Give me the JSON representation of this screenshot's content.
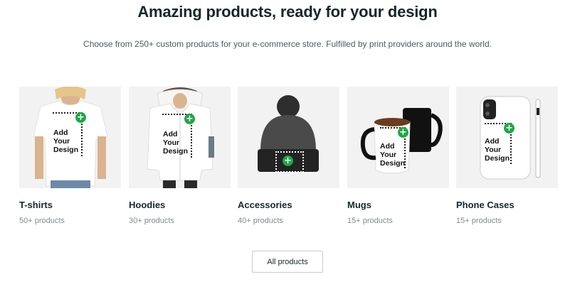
{
  "header": {
    "title": "Amazing products, ready for your design",
    "subtitle": "Choose from 250+ custom products for your e-commerce store. Fulfilled by print providers around the world."
  },
  "overlay": {
    "text": "Add\nYour\nDesign",
    "plus": "+"
  },
  "products": [
    {
      "title": "T-shirts",
      "count": "50+ products"
    },
    {
      "title": "Hoodies",
      "count": "30+ products"
    },
    {
      "title": "Accessories",
      "count": "40+ products"
    },
    {
      "title": "Mugs",
      "count": "15+ products"
    },
    {
      "title": "Phone Cases",
      "count": "15+ products"
    }
  ],
  "cta": {
    "label": "All products"
  },
  "colors": {
    "accent_green": "#1fa645",
    "card_bg": "#f2f2f2",
    "text_dark": "#17262b",
    "text_muted": "#818a8e"
  }
}
